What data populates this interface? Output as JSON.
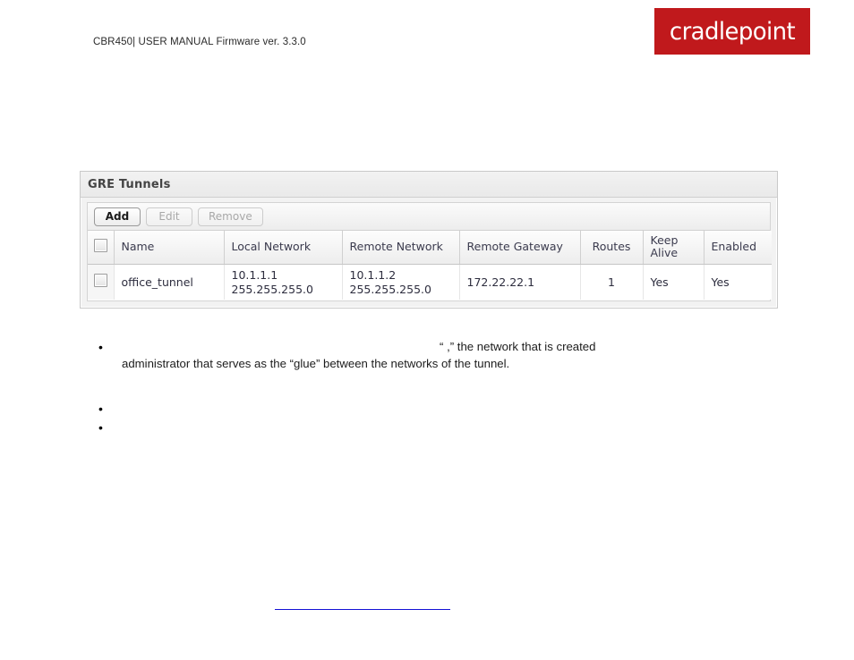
{
  "document": {
    "header_text": "CBR450| USER MANUAL Firmware ver. 3.3.0",
    "brand": "cradlepoint",
    "brand_color": "#c0191c"
  },
  "panel": {
    "title": "GRE Tunnels",
    "toolbar": {
      "add_label": "Add",
      "edit_label": "Edit",
      "remove_label": "Remove"
    },
    "grid": {
      "columns": [
        {
          "key": "check",
          "label": ""
        },
        {
          "key": "name",
          "label": "Name"
        },
        {
          "key": "local_network",
          "label": "Local Network"
        },
        {
          "key": "remote_network",
          "label": "Remote Network"
        },
        {
          "key": "remote_gateway",
          "label": "Remote Gateway"
        },
        {
          "key": "routes",
          "label": "Routes"
        },
        {
          "key": "keep_alive",
          "label": "Keep Alive"
        },
        {
          "key": "enabled",
          "label": "Enabled"
        }
      ],
      "rows": [
        {
          "name": "office_tunnel",
          "local_network_ip": "10.1.1.1",
          "local_network_mask": "255.255.255.0",
          "remote_network_ip": "10.1.1.2",
          "remote_network_mask": "255.255.255.0",
          "remote_gateway": "172.22.22.1",
          "routes": "1",
          "keep_alive": "Yes",
          "enabled": "Yes"
        }
      ]
    }
  },
  "body": {
    "bullets": [
      {
        "line1_before": "“",
        "line1_hidden": "                    ",
        "line1_after": ",” the network that is created",
        "line2": "administrator that serves as the “glue” between the networks of the tunnel."
      },
      {
        "line1_before": "",
        "line1_hidden": "",
        "line1_after": "",
        "line2": ""
      },
      {
        "line1_before": "",
        "line1_hidden": "",
        "line1_after": "",
        "line2": ""
      }
    ],
    "link_text": "",
    "link_color": "#1411d6"
  }
}
